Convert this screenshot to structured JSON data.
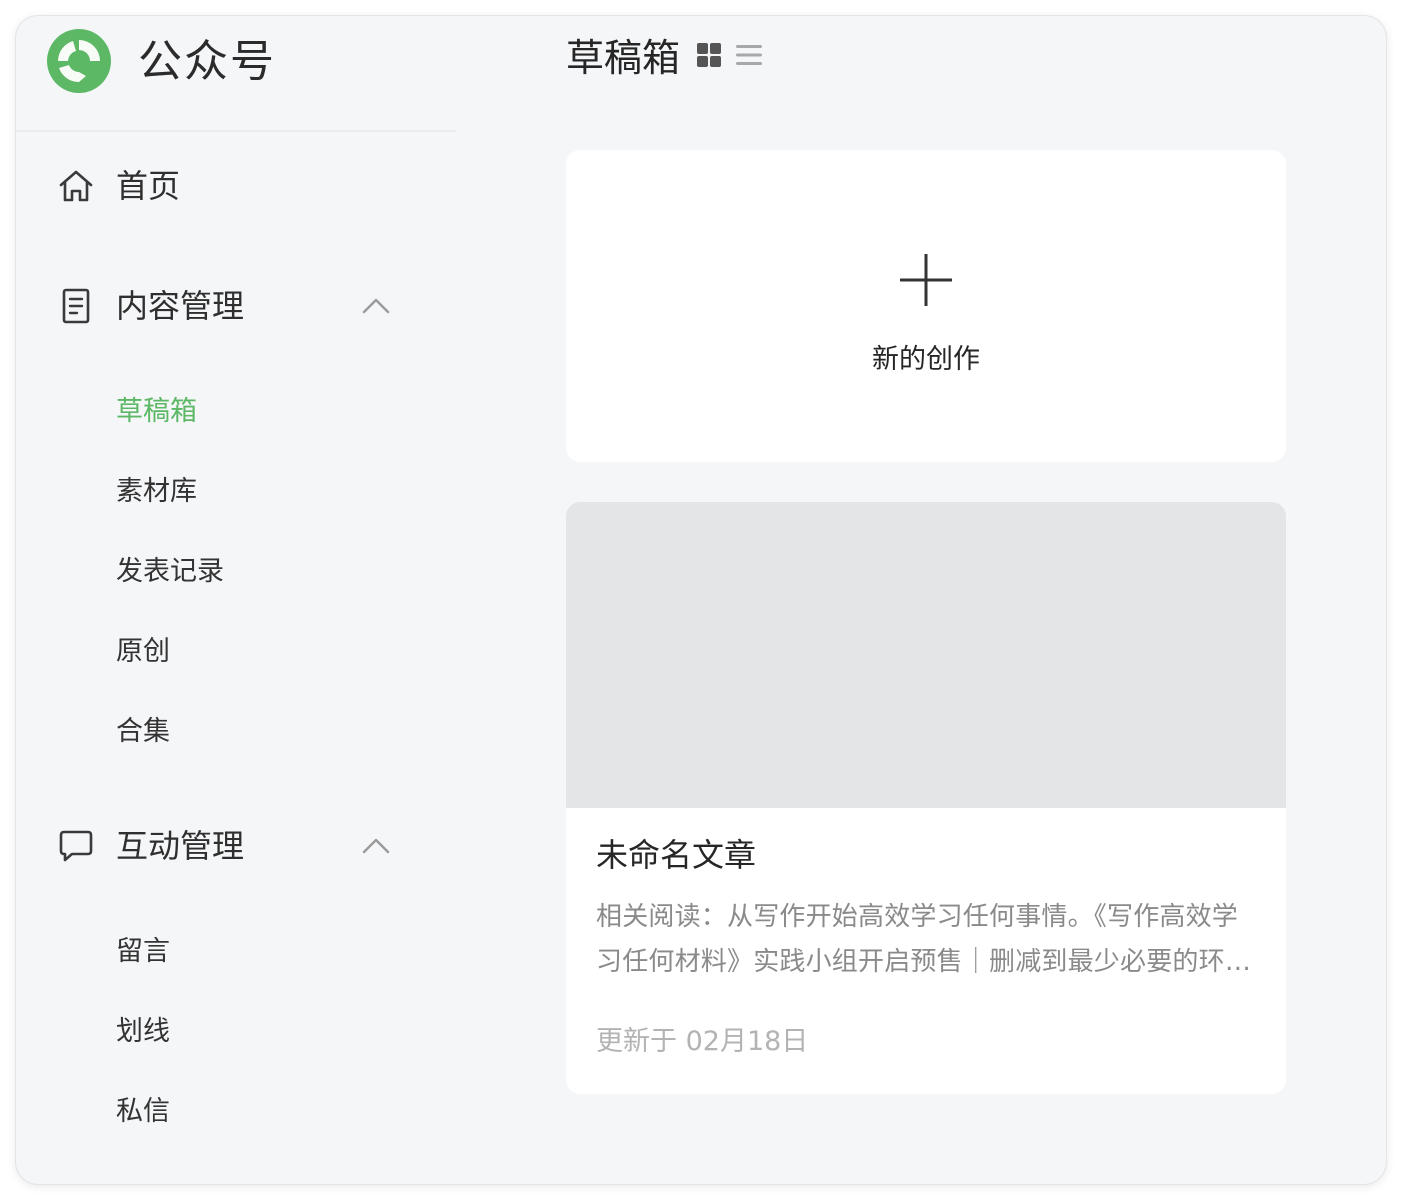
{
  "brand": {
    "name": "公众号",
    "accent": "#5db866"
  },
  "sidebar": {
    "home": {
      "label": "首页",
      "icon": "home-icon"
    },
    "content": {
      "label": "内容管理",
      "icon": "document-icon",
      "expanded": true,
      "items": [
        {
          "label": "草稿箱",
          "active": true
        },
        {
          "label": "素材库",
          "active": false
        },
        {
          "label": "发表记录",
          "active": false
        },
        {
          "label": "原创",
          "active": false
        },
        {
          "label": "合集",
          "active": false
        }
      ]
    },
    "interaction": {
      "label": "互动管理",
      "icon": "chat-bubble-icon",
      "expanded": true,
      "items": [
        {
          "label": "留言"
        },
        {
          "label": "划线"
        },
        {
          "label": "私信"
        }
      ]
    }
  },
  "main": {
    "title": "草稿箱",
    "view_modes": [
      "grid-view-icon",
      "list-view-icon"
    ],
    "new_card": {
      "label": "新的创作",
      "icon": "plus-icon"
    },
    "articles": [
      {
        "title": "未命名文章",
        "summary": "相关阅读：从写作开始高效学习任何事情。《写作高效学习任何材料》实践小组开启预售｜删减到最少必要的环节，让你开始写作",
        "updated": "更新于 02月18日"
      }
    ]
  }
}
